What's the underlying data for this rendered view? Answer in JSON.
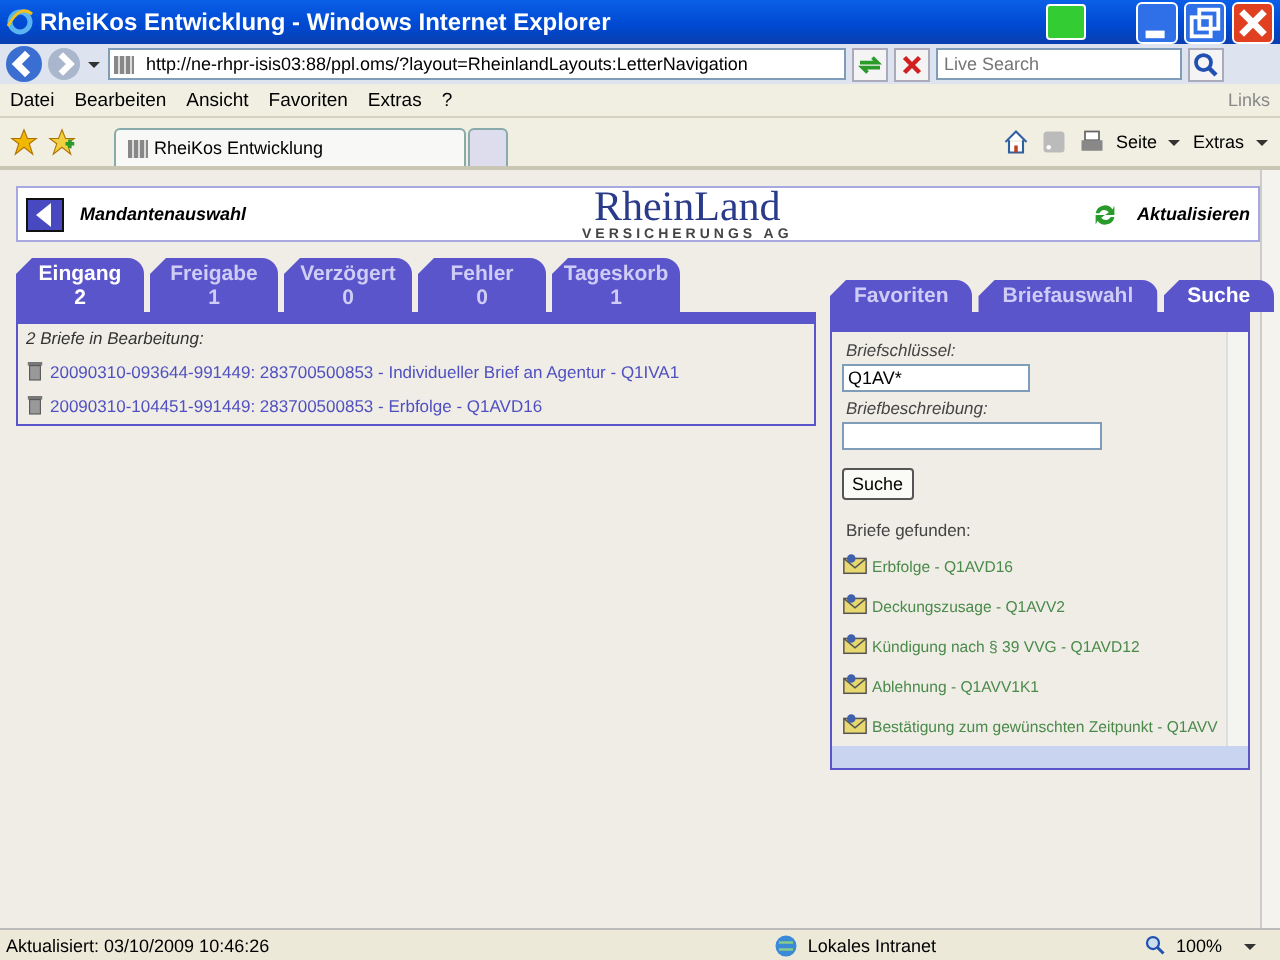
{
  "window": {
    "title": "RheiKos Entwicklung - Windows Internet Explorer"
  },
  "address_bar": {
    "url": "http://ne-rhpr-isis03:88/ppl.oms/?layout=RheinlandLayouts:LetterNavigation",
    "search_placeholder": "Live Search"
  },
  "menu": [
    "Datei",
    "Bearbeiten",
    "Ansicht",
    "Favoriten",
    "Extras",
    "?"
  ],
  "links_label": "Links",
  "browser_tab": {
    "title": "RheiKos Entwicklung"
  },
  "command_bar": [
    "Seite",
    "Extras"
  ],
  "header": {
    "back_label": "Mandantenauswahl",
    "logo": "RheinLand",
    "logo_sub": "VERSICHERUNGS AG",
    "refresh_label": "Aktualisieren"
  },
  "inbox": {
    "tabs": [
      {
        "label": "Eingang",
        "count": "2",
        "selected": true
      },
      {
        "label": "Freigabe",
        "count": "1",
        "selected": false
      },
      {
        "label": "Verzögert",
        "count": "0",
        "selected": false
      },
      {
        "label": "Fehler",
        "count": "0",
        "selected": false
      },
      {
        "label": "Tageskorb",
        "count": "1",
        "selected": false
      }
    ],
    "summary": "2 Briefe in Bearbeitung:",
    "items": [
      "20090310-093644-991449: 283700500853 - Individueller Brief an Agentur - Q1IVA1",
      "20090310-104451-991449: 283700500853 - Erbfolge - Q1AVD16"
    ]
  },
  "search_panel": {
    "tabs": [
      {
        "label": "Favoriten",
        "selected": false
      },
      {
        "label": "Briefauswahl",
        "selected": false
      },
      {
        "label": "Suche",
        "selected": true
      }
    ],
    "key_label": "Briefschlüssel:",
    "key_value": "Q1AV*",
    "desc_label": "Briefbeschreibung:",
    "button": "Suche",
    "results_label": "Briefe gefunden:",
    "results": [
      "Erbfolge - Q1AVD16",
      "Deckungszusage - Q1AVV2",
      "Kündigung nach § 39 VVG - Q1AVD12",
      "Ablehnung - Q1AVV1K1",
      "Bestätigung zum gewünschten Zeitpunkt - Q1AVV"
    ]
  },
  "status_bar": {
    "text": "Aktualisiert: 03/10/2009 10:46:26",
    "zone": "Lokales Intranet",
    "zoom": "100%"
  }
}
